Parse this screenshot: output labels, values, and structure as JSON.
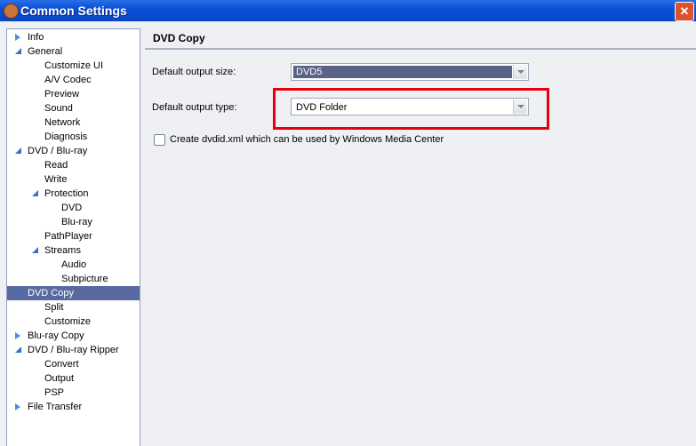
{
  "window": {
    "title": "Common Settings",
    "close": "✕"
  },
  "tree": [
    {
      "label": "Info",
      "level": 0,
      "state": "collapsed"
    },
    {
      "label": "General",
      "level": 0,
      "state": "open"
    },
    {
      "label": "Customize UI",
      "level": 1
    },
    {
      "label": "A/V Codec",
      "level": 1
    },
    {
      "label": "Preview",
      "level": 1
    },
    {
      "label": "Sound",
      "level": 1
    },
    {
      "label": "Network",
      "level": 1
    },
    {
      "label": "Diagnosis",
      "level": 1
    },
    {
      "label": "DVD / Blu-ray",
      "level": 0,
      "state": "open"
    },
    {
      "label": "Read",
      "level": 1
    },
    {
      "label": "Write",
      "level": 1
    },
    {
      "label": "Protection",
      "level": 1,
      "state": "open"
    },
    {
      "label": "DVD",
      "level": 2
    },
    {
      "label": "Blu-ray",
      "level": 2
    },
    {
      "label": "PathPlayer",
      "level": 1
    },
    {
      "label": "Streams",
      "level": 1,
      "state": "open"
    },
    {
      "label": "Audio",
      "level": 2
    },
    {
      "label": "Subpicture",
      "level": 2
    },
    {
      "label": "DVD Copy",
      "level": 0,
      "state": "open",
      "selected": true
    },
    {
      "label": "Split",
      "level": 1
    },
    {
      "label": "Customize",
      "level": 1
    },
    {
      "label": "Blu-ray Copy",
      "level": 0,
      "state": "collapsed"
    },
    {
      "label": "DVD / Blu-ray Ripper",
      "level": 0,
      "state": "open"
    },
    {
      "label": "Convert",
      "level": 1
    },
    {
      "label": "Output",
      "level": 1
    },
    {
      "label": "PSP",
      "level": 1
    },
    {
      "label": "File Transfer",
      "level": 0,
      "state": "collapsed"
    }
  ],
  "panel": {
    "title": "DVD Copy",
    "output_size_label": "Default output size:",
    "output_size_value": "DVD5",
    "output_type_label": "Default output type:",
    "output_type_value": "DVD Folder",
    "checkbox_label": "Create dvdid.xml which can be used by Windows Media Center",
    "checkbox_checked": false
  }
}
